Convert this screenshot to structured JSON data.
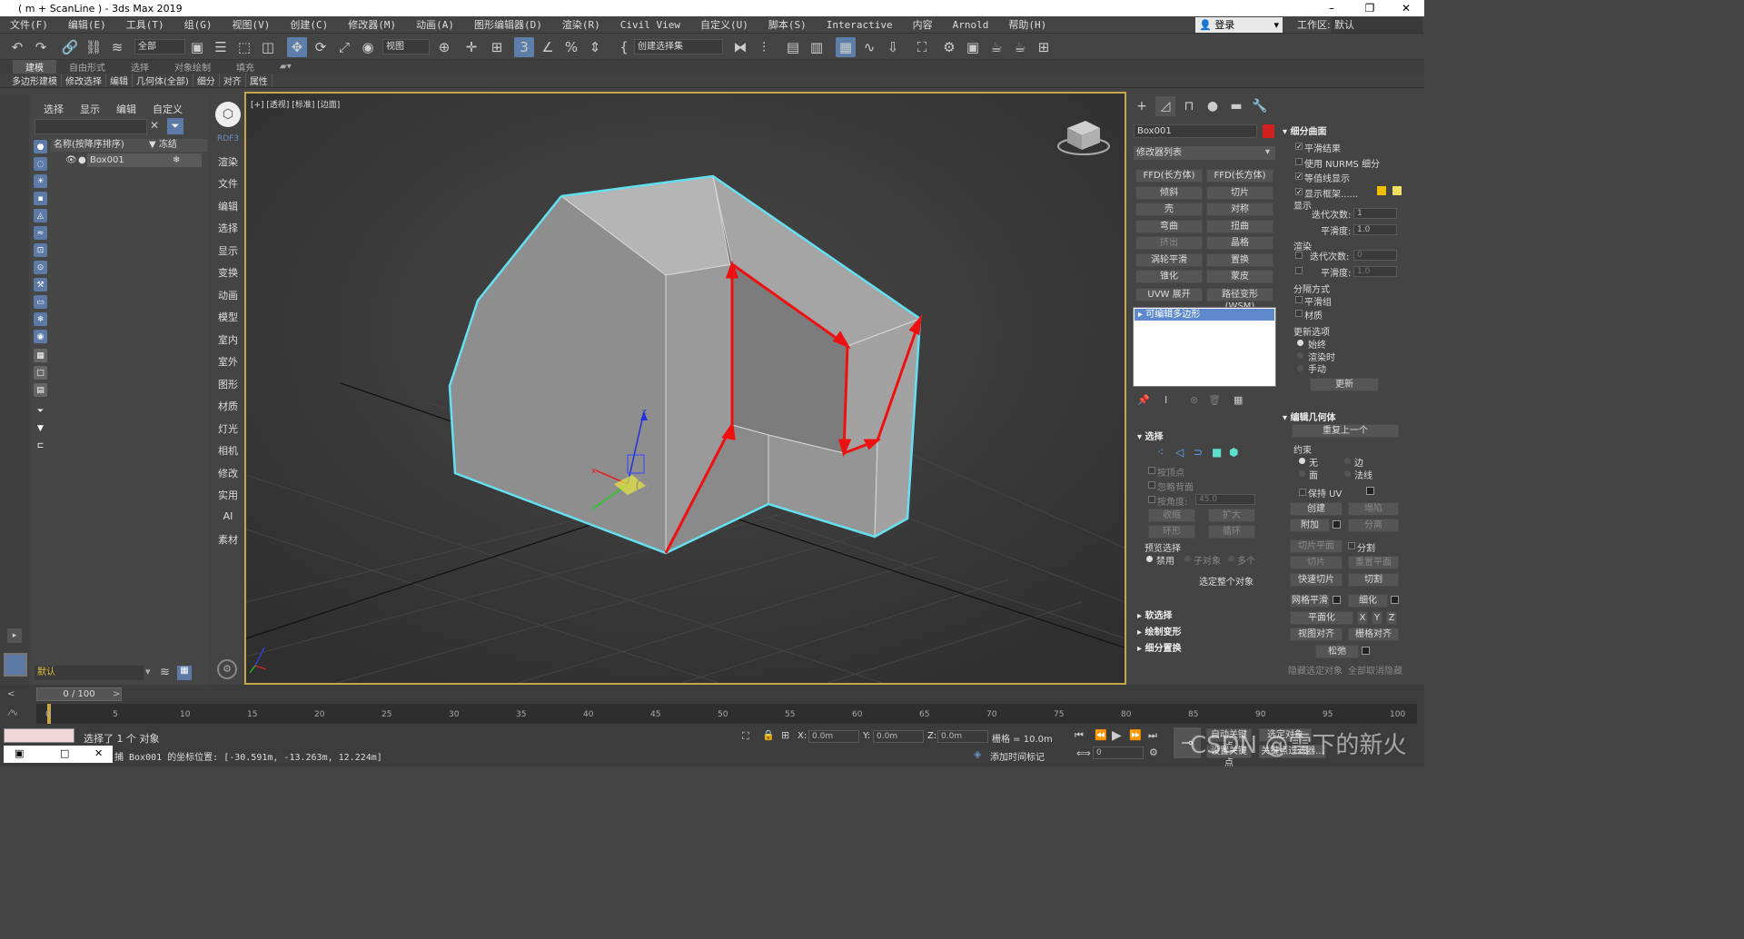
{
  "title": "( m + ScanLine ) - 3ds Max 2019",
  "window_controls": {
    "min": "–",
    "max": "❐",
    "close": "✕"
  },
  "menu": [
    "文件(F)",
    "编辑(E)",
    "工具(T)",
    "组(G)",
    "视图(V)",
    "创建(C)",
    "修改器(M)",
    "动画(A)",
    "图形编辑器(D)",
    "渲染(R)",
    "Civil View",
    "自定义(U)",
    "脚本(S)",
    "Interactive",
    "内容",
    "Arnold",
    "帮助(H)"
  ],
  "login": "登录",
  "workspace": {
    "label": "工作区:",
    "value": "默认"
  },
  "toolbar": {
    "selection_filter": "全部",
    "ref_coord": "视图",
    "named_sel": "创建选择集"
  },
  "ribbon_tabs": [
    "建模",
    "自由形式",
    "选择",
    "对象绘制",
    "填充"
  ],
  "ribbon_row": [
    "多边形建模",
    "修改选择",
    "编辑",
    "几何体(全部)",
    "细分",
    "对齐",
    "属性"
  ],
  "scene_explorer": {
    "tabs": [
      "选择",
      "显示",
      "编辑",
      "自定义"
    ],
    "col_name": "名称(按降序排序)",
    "col_freeze": "▼ 冻结",
    "rows": [
      {
        "name": "Box001"
      }
    ]
  },
  "side_nav": {
    "top": "RDF3",
    "items": [
      "渲染",
      "文件",
      "编辑",
      "选择",
      "显示",
      "变换",
      "动画",
      "模型",
      "室内",
      "室外",
      "图形",
      "材质",
      "灯光",
      "相机",
      "修改",
      "实用",
      "AI",
      "素材"
    ]
  },
  "layer_field": "默认",
  "viewport": {
    "label": "[+] [透视] [标准] [边面]"
  },
  "cmd_panel": {
    "object_name": "Box001",
    "object_color": "#d02020",
    "modifier_list": "修改器列表",
    "modifier_buttons": [
      "FFD(长方体)",
      "FFD(长方体)",
      "倾斜",
      "切片",
      "壳",
      "对称",
      "弯曲",
      "扭曲",
      "挤出",
      "晶格",
      "涡轮平滑",
      "置换",
      "锥化",
      "蒙皮",
      "UVW 展开",
      "路径变形 (WSM)"
    ],
    "stack_item": "可编辑多边形",
    "rollouts": {
      "selection": "选择",
      "by_vertex": "按顶点",
      "ignore_backface": "忽略背面",
      "by_angle": "按角度:",
      "angle_val": "45.0",
      "shrink": "收缩",
      "grow": "扩大",
      "ring": "环形",
      "loop": "循环",
      "preview_sel": "预览选择",
      "disabled": "禁用",
      "sub_object": "子对象",
      "multi": "多个",
      "whole_object": "选定整个对象",
      "soft_sel": "软选择",
      "paint_deform": "绘制变形",
      "subdiv_disp": "细分置换"
    },
    "subdiv": {
      "title": "细分曲面",
      "smooth_result": "平滑结果",
      "use_nurms": "使用 NURMS 细分",
      "isoline": "等值线显示",
      "show_cage": "显示框架......",
      "display": "显示",
      "iterations": "迭代次数:",
      "iter_val": "1",
      "smoothness": "平滑度:",
      "smooth_val": "1.0",
      "render": "渲染",
      "r_iter_val": "0",
      "r_smooth_val": "1.0",
      "separate": "分隔方式",
      "smoothing_groups": "平滑组",
      "materials": "材质",
      "update_opts": "更新选项",
      "always": "始终",
      "when_rendering": "渲染时",
      "manually": "手动",
      "update": "更新"
    },
    "edit_geom": {
      "title": "编辑几何体",
      "repeat_last": "重复上一个",
      "constraints": "约束",
      "none": "无",
      "edge": "边",
      "face": "面",
      "normal": "法线",
      "preserve_uv": "保持 UV",
      "create": "创建",
      "collapse": "塌陷",
      "attach": "附加",
      "detach": "分离",
      "slice_plane": "切片平面",
      "split": "分割",
      "slice": "切片",
      "reset_plane": "重置平面",
      "quickslice": "快速切片",
      "cut": "切割",
      "meshsmooth": "网格平滑",
      "tessellate": "细化",
      "make_planar": "平面化",
      "x": "X",
      "y": "Y",
      "z": "Z",
      "view_align": "视图对齐",
      "grid_align": "栅格对齐",
      "relax": "松弛",
      "hide_sel": "隐藏选定对象",
      "unhide_all": "全部取消隐藏"
    }
  },
  "timeline": {
    "slider": "0 / 100",
    "ticks": [
      0,
      5,
      10,
      15,
      20,
      25,
      30,
      35,
      40,
      45,
      50,
      55,
      60,
      65,
      70,
      75,
      80,
      85,
      90,
      95,
      100
    ]
  },
  "status": {
    "selected": "选择了 1 个 对象",
    "coords_msg": "捕 Box001 的坐标位置: [-30.591m, -13.263m, 12.224m]",
    "x_label": "X:",
    "x_val": "0.0m",
    "y_label": "Y:",
    "y_val": "0.0m",
    "z_label": "Z:",
    "z_val": "0.0m",
    "grid": "栅格 = 10.0m",
    "add_time_tag": "添加时间标记",
    "frame": "0",
    "auto_key": "自动关键点",
    "set_key": "设置关键点",
    "selected_obj": "选定对象",
    "key_filters": "关键点过滤器...",
    "watermark": "CSDN @雪下的新火"
  },
  "colors": {
    "accent": "#5d7aa6",
    "viewport_border": "#c8a64b",
    "highlight": "#64e0f0",
    "edge_red": "#ee1111"
  }
}
